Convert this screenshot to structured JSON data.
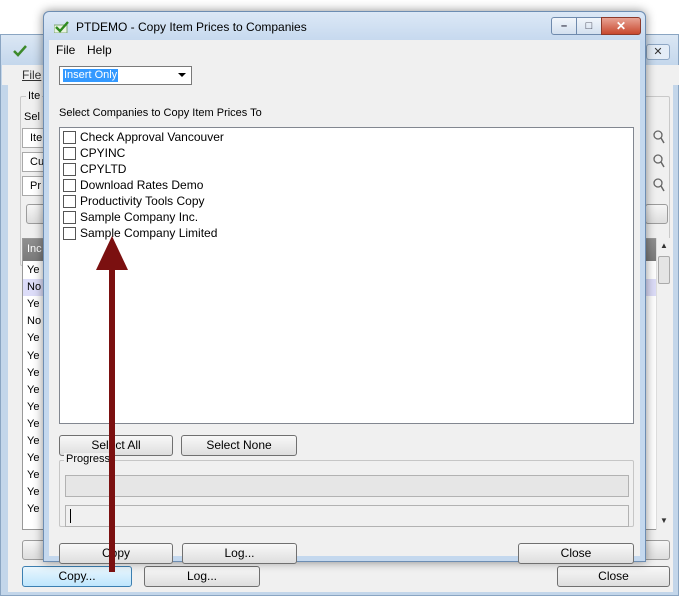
{
  "background_window": {
    "title": "",
    "close_glyph": "✕",
    "menu_file": "File",
    "group_title": "Ite",
    "select_label": "Sel",
    "field_labels": [
      "Ite",
      "Cu",
      "Pr"
    ],
    "grid_header": "Inc",
    "grid_rows": [
      "Ye",
      "No",
      "Ye",
      "No",
      "Ye",
      "Ye",
      "Ye",
      "Ye",
      "Ye",
      "Ye",
      "Ye",
      "Ye",
      "Ye",
      "Ye",
      "Ye"
    ],
    "selected_row_index": 1,
    "buttons": {
      "copy": "Copy...",
      "log": "Log...",
      "close": "Close"
    }
  },
  "dialog": {
    "title": "PTDEMO - Copy Item Prices to Companies",
    "caption_buttons": {
      "minimize": "–",
      "maximize": "□",
      "close": "✕"
    },
    "menu": [
      "File",
      "Help"
    ],
    "mode_select": {
      "selected": "Insert Only"
    },
    "list_label": "Select Companies to Copy Item Prices To",
    "companies": [
      "Check Approval Vancouver",
      "CPYINC",
      "CPYLTD",
      "Download Rates Demo",
      "Productivity Tools Copy",
      "Sample Company Inc.",
      "Sample Company Limited"
    ],
    "select_all_label": "Select All",
    "select_none_label": "Select None",
    "progress_label": "Progress",
    "buttons": {
      "copy": "Copy",
      "log": "Log...",
      "close": "Close"
    }
  },
  "colors": {
    "annotation_arrow": "#7b1010",
    "selection": "#3399ff"
  }
}
